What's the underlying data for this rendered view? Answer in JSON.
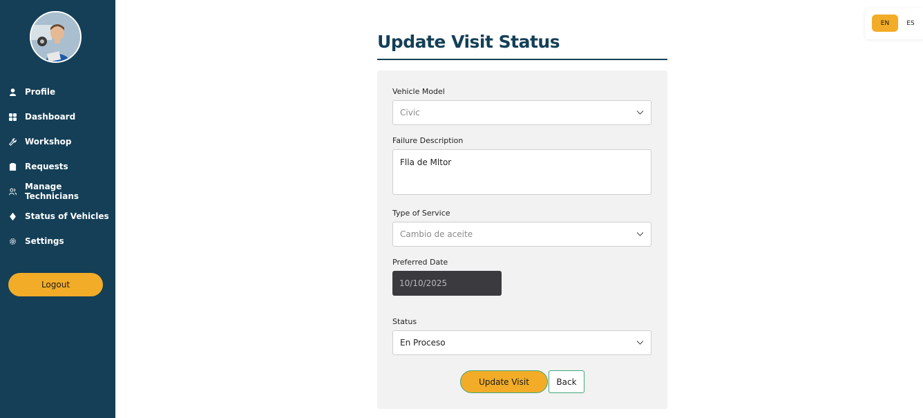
{
  "sidebar": {
    "avatar_icon": "technician-avatar",
    "items": [
      {
        "label": "Profile",
        "icon": "user-icon"
      },
      {
        "label": "Dashboard",
        "icon": "grid-icon"
      },
      {
        "label": "Workshop",
        "icon": "wrench-icon"
      },
      {
        "label": "Requests",
        "icon": "clipboard-icon"
      },
      {
        "label": "Manage Technicians",
        "icon": "users-icon"
      },
      {
        "label": "Status of Vehicles",
        "icon": "diamond-icon"
      },
      {
        "label": "Settings",
        "icon": "gear-icon"
      }
    ],
    "logout_label": "Logout"
  },
  "language": {
    "active": "EN",
    "other": "ES"
  },
  "page": {
    "title": "Update Visit Status"
  },
  "form": {
    "vehicle_model": {
      "label": "Vehicle Model",
      "value": "Civic"
    },
    "failure_description": {
      "label": "Failure Description",
      "value": "Flla de Mltor"
    },
    "type_of_service": {
      "label": "Type of Service",
      "value": "Cambio de aceite"
    },
    "preferred_date": {
      "label": "Preferred Date",
      "value": "10/10/2025"
    },
    "status": {
      "label": "Status",
      "value": "En Proceso"
    },
    "update_label": "Update Visit",
    "back_label": "Back"
  },
  "colors": {
    "sidebar_bg": "#143f57",
    "accent": "#f2ac27",
    "title": "#143f57",
    "card_bg": "#f2f2f2",
    "button_border": "#3fa67a"
  }
}
